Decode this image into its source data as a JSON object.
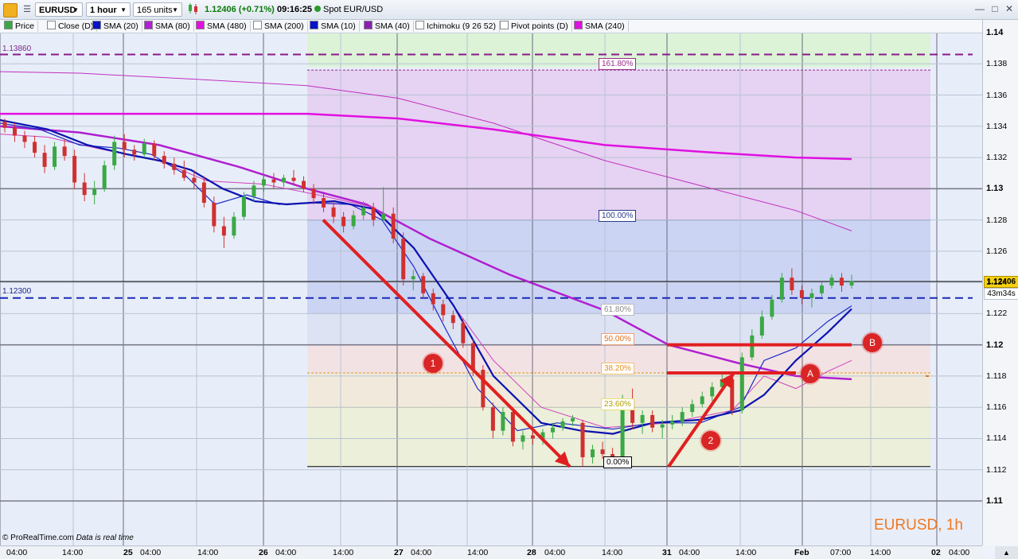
{
  "toolbar": {
    "symbol": "EURUSD",
    "timeframe": "1 hour",
    "units": "165 units",
    "price": "1.12406",
    "change": "(+0.71%)",
    "time": "09:16:25",
    "instrument": "Spot EUR/USD"
  },
  "legend": [
    {
      "label": "Price",
      "color": "#3aa845"
    },
    {
      "label": "Close (D)",
      "color": "#ffffff"
    },
    {
      "label": "SMA (20)",
      "color": "#0a12c8"
    },
    {
      "label": "SMA (80)",
      "color": "#b020d0"
    },
    {
      "label": "SMA (480)",
      "color": "#e010e0"
    },
    {
      "label": "SMA (200)",
      "color": "#ffffff"
    },
    {
      "label": "SMA (10)",
      "color": "#0a12c8"
    },
    {
      "label": "SMA (40)",
      "color": "#8a22b0"
    },
    {
      "label": "Ichimoku (9 26 52)",
      "color": "#ffffff"
    },
    {
      "label": "Pivot points (D)",
      "color": "#ffffff"
    },
    {
      "label": "SMA (240)",
      "color": "#e010e0"
    }
  ],
  "y_axis": [
    "1.14",
    "1.138",
    "1.136",
    "1.134",
    "1.132",
    "1.13",
    "1.128",
    "1.126",
    "1.124",
    "1.122",
    "1.12",
    "1.118",
    "1.116",
    "1.114",
    "1.112",
    "1.11"
  ],
  "price_tag": "1.12406",
  "countdown": "43m34s",
  "levels": {
    "upper": "1.13860",
    "lower": "1.12300"
  },
  "fib": [
    {
      "label": "161.80%",
      "color": "#9a2a8a"
    },
    {
      "label": "100.00%",
      "color": "#2a3a8a"
    },
    {
      "label": "61.80%",
      "color": "#8a8a8a"
    },
    {
      "label": "50.00%",
      "color": "#e07020"
    },
    {
      "label": "38.20%",
      "color": "#e09020"
    },
    {
      "label": "23.60%",
      "color": "#c8b800"
    },
    {
      "label": "0.00%",
      "color": "#000000"
    }
  ],
  "x_axis": [
    {
      "label": "04:00",
      "bold": false
    },
    {
      "label": "14:00",
      "bold": false
    },
    {
      "label": "25",
      "bold": true
    },
    {
      "label": "04:00",
      "bold": false
    },
    {
      "label": "14:00",
      "bold": false
    },
    {
      "label": "26",
      "bold": true
    },
    {
      "label": "04:00",
      "bold": false
    },
    {
      "label": "14:00",
      "bold": false
    },
    {
      "label": "27",
      "bold": true
    },
    {
      "label": "04:00",
      "bold": false
    },
    {
      "label": "14:00",
      "bold": false
    },
    {
      "label": "28",
      "bold": true
    },
    {
      "label": "04:00",
      "bold": false
    },
    {
      "label": "14:00",
      "bold": false
    },
    {
      "label": "31",
      "bold": true
    },
    {
      "label": "04:00",
      "bold": false
    },
    {
      "label": "14:00",
      "bold": false
    },
    {
      "label": "Feb",
      "bold": true
    },
    {
      "label": "07:00",
      "bold": false
    },
    {
      "label": "14:00",
      "bold": false
    },
    {
      "label": "02",
      "bold": true
    },
    {
      "label": "04:00",
      "bold": false
    }
  ],
  "markers": [
    "1",
    "2",
    "A",
    "B"
  ],
  "watermark": "© ProRealTime.com",
  "realtime": "Data is real time",
  "symbol_title": "EURUSD, 1h",
  "chart_data": {
    "type": "candlestick",
    "title": "EURUSD, 1h",
    "ylim": [
      1.1095,
      1.1405
    ],
    "candles": [
      [
        1.1343,
        1.1345,
        1.1336,
        1.1339
      ],
      [
        1.1339,
        1.1342,
        1.133,
        1.1334
      ],
      [
        1.1334,
        1.1337,
        1.1326,
        1.133
      ],
      [
        1.133,
        1.1334,
        1.132,
        1.1323
      ],
      [
        1.1323,
        1.1328,
        1.131,
        1.1314
      ],
      [
        1.1314,
        1.133,
        1.1312,
        1.1327
      ],
      [
        1.1327,
        1.1332,
        1.1318,
        1.1321
      ],
      [
        1.1321,
        1.1325,
        1.13,
        1.1304
      ],
      [
        1.1304,
        1.131,
        1.1292,
        1.1296
      ],
      [
        1.1296,
        1.1305,
        1.129,
        1.13
      ],
      [
        1.13,
        1.1318,
        1.1298,
        1.1315
      ],
      [
        1.1315,
        1.1334,
        1.1312,
        1.133
      ],
      [
        1.133,
        1.1335,
        1.132,
        1.1325
      ],
      [
        1.1325,
        1.1328,
        1.1318,
        1.1322
      ],
      [
        1.1322,
        1.1332,
        1.132,
        1.1329
      ],
      [
        1.1329,
        1.1331,
        1.1318,
        1.1321
      ],
      [
        1.1321,
        1.1324,
        1.1313,
        1.1316
      ],
      [
        1.1316,
        1.132,
        1.1309,
        1.1312
      ],
      [
        1.1312,
        1.1318,
        1.1305,
        1.1307
      ],
      [
        1.1307,
        1.1312,
        1.13,
        1.1304
      ],
      [
        1.1304,
        1.1308,
        1.1288,
        1.1291
      ],
      [
        1.1291,
        1.1295,
        1.1272,
        1.1276
      ],
      [
        1.1276,
        1.1282,
        1.1262,
        1.127
      ],
      [
        1.127,
        1.1285,
        1.1268,
        1.1282
      ],
      [
        1.1282,
        1.1298,
        1.128,
        1.1295
      ],
      [
        1.1295,
        1.1305,
        1.1292,
        1.1302
      ],
      [
        1.1302,
        1.1309,
        1.1298,
        1.1306
      ],
      [
        1.1306,
        1.131,
        1.13,
        1.1304
      ],
      [
        1.1304,
        1.1309,
        1.1301,
        1.1307
      ],
      [
        1.1307,
        1.1312,
        1.1302,
        1.1305
      ],
      [
        1.1305,
        1.1308,
        1.1298,
        1.13
      ],
      [
        1.13,
        1.1303,
        1.129,
        1.1294
      ],
      [
        1.1294,
        1.1298,
        1.1285,
        1.1288
      ],
      [
        1.1288,
        1.1292,
        1.1278,
        1.1282
      ],
      [
        1.1282,
        1.1285,
        1.1272,
        1.1276
      ],
      [
        1.1276,
        1.1286,
        1.1274,
        1.1283
      ],
      [
        1.1283,
        1.1292,
        1.128,
        1.1288
      ],
      [
        1.1288,
        1.1291,
        1.1276,
        1.128
      ],
      [
        1.128,
        1.1301,
        1.1278,
        1.1284
      ],
      [
        1.1284,
        1.1288,
        1.1265,
        1.1268
      ],
      [
        1.1268,
        1.1272,
        1.1238,
        1.1242
      ],
      [
        1.1242,
        1.1248,
        1.1235,
        1.1244
      ],
      [
        1.1244,
        1.1246,
        1.123,
        1.1233
      ],
      [
        1.1233,
        1.1236,
        1.1222,
        1.1226
      ],
      [
        1.1226,
        1.1229,
        1.1215,
        1.1219
      ],
      [
        1.1219,
        1.1222,
        1.121,
        1.1214
      ],
      [
        1.1214,
        1.1217,
        1.1198,
        1.1201
      ],
      [
        1.1201,
        1.1204,
        1.118,
        1.1184
      ],
      [
        1.1184,
        1.1187,
        1.1158,
        1.116
      ],
      [
        1.116,
        1.1163,
        1.114,
        1.1145
      ],
      [
        1.1145,
        1.116,
        1.1142,
        1.1157
      ],
      [
        1.1157,
        1.116,
        1.1135,
        1.1138
      ],
      [
        1.1138,
        1.1145,
        1.1133,
        1.1142
      ],
      [
        1.1142,
        1.1147,
        1.1136,
        1.114
      ],
      [
        1.114,
        1.1146,
        1.1136,
        1.1144
      ],
      [
        1.1144,
        1.115,
        1.114,
        1.1147
      ],
      [
        1.1147,
        1.1153,
        1.1145,
        1.1151
      ],
      [
        1.1151,
        1.1155,
        1.1148,
        1.1153
      ],
      [
        1.115,
        1.1152,
        1.1122,
        1.1128
      ],
      [
        1.1128,
        1.1136,
        1.1124,
        1.1133
      ],
      [
        1.1133,
        1.1138,
        1.1127,
        1.113
      ],
      [
        1.113,
        1.1134,
        1.1122,
        1.1126
      ],
      [
        1.1126,
        1.1168,
        1.1124,
        1.1164
      ],
      [
        1.1164,
        1.1172,
        1.1146,
        1.115
      ],
      [
        1.115,
        1.1158,
        1.1143,
        1.1155
      ],
      [
        1.1155,
        1.1158,
        1.1144,
        1.1147
      ],
      [
        1.1147,
        1.1152,
        1.114,
        1.1149
      ],
      [
        1.1149,
        1.1155,
        1.1146,
        1.1151
      ],
      [
        1.1151,
        1.116,
        1.1148,
        1.1157
      ],
      [
        1.1157,
        1.1165,
        1.1154,
        1.1162
      ],
      [
        1.1162,
        1.117,
        1.116,
        1.1167
      ],
      [
        1.1167,
        1.1176,
        1.1164,
        1.1173
      ],
      [
        1.1173,
        1.1182,
        1.117,
        1.1178
      ],
      [
        1.1178,
        1.1182,
        1.1155,
        1.1158
      ],
      [
        1.1158,
        1.1195,
        1.1156,
        1.1192
      ],
      [
        1.1192,
        1.121,
        1.119,
        1.1206
      ],
      [
        1.1206,
        1.1222,
        1.1204,
        1.1218
      ],
      [
        1.1218,
        1.1232,
        1.1216,
        1.1229
      ],
      [
        1.1229,
        1.1246,
        1.1227,
        1.1243
      ],
      [
        1.1243,
        1.1249,
        1.1232,
        1.1235
      ],
      [
        1.1235,
        1.1238,
        1.1226,
        1.123
      ],
      [
        1.123,
        1.1236,
        1.1224,
        1.1233
      ],
      [
        1.1233,
        1.124,
        1.1231,
        1.1238
      ],
      [
        1.1238,
        1.1245,
        1.1236,
        1.1243
      ],
      [
        1.1243,
        1.1246,
        1.1234,
        1.1238
      ],
      [
        1.1238,
        1.1245,
        1.1236,
        1.1241
      ]
    ],
    "sma": [
      {
        "name": "SMA (480)",
        "color": "#e010e0",
        "width": 2,
        "points": [
          [
            1.1348,
            1.1349,
            1.1346,
            1.1338,
            1.1327,
            1.1321,
            1.1319
          ]
        ]
      },
      {
        "name": "SMA (240)",
        "color": "#c020c0",
        "width": 1,
        "points": [
          [
            1.1375,
            1.1372,
            1.1362,
            1.1342,
            1.1318,
            1.1296,
            1.1281,
            1.1273
          ]
        ]
      }
    ]
  }
}
